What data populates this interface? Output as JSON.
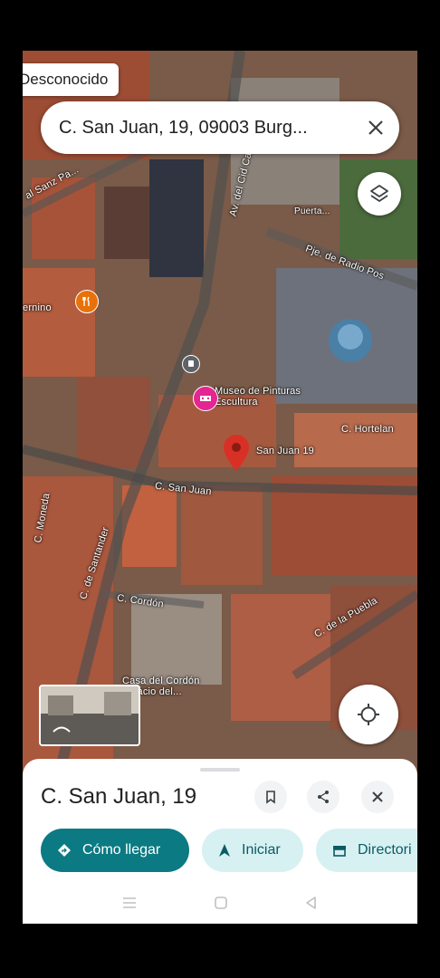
{
  "status": {
    "label": "Desconocido"
  },
  "search": {
    "query": "C. San Juan, 19, 09003 Burg..."
  },
  "map": {
    "street_labels": [
      "al Sanz Pa...",
      "Av. del Cid Campeador",
      "Pje. de Radio Pos",
      "C. Hortelan",
      "C. San Juan",
      "C. de Santander",
      "C. Moneda",
      "C. Cordón",
      "C. de la Puebla",
      "ernino",
      "Puerta..."
    ],
    "poi_labels": [
      "Museo de Pinturas Escultura",
      "San Juan 19",
      "Casa del Cordón Palacio del..."
    ],
    "pin_color": "#d93025"
  },
  "place": {
    "title": "C. San Juan, 19"
  },
  "actions": {
    "directions": "Cómo llegar",
    "start": "Iniciar",
    "directory": "Directori"
  },
  "colors": {
    "primary": "#0b7a83",
    "secondary_bg": "#d7f1f3"
  }
}
